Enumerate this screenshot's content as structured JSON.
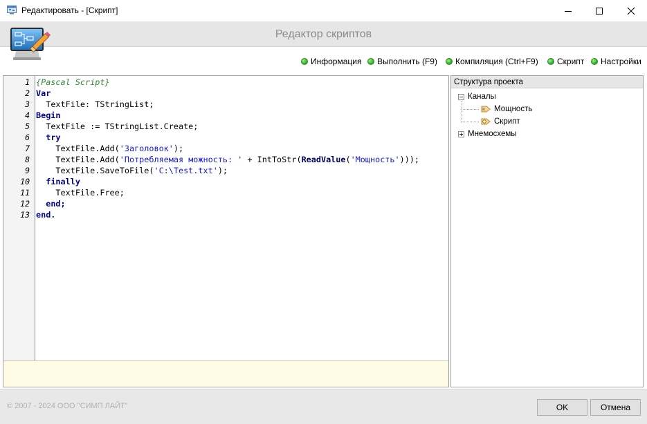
{
  "window": {
    "title": "Редактировать - [Скрипт]"
  },
  "header": {
    "title": "Редактор скриптов"
  },
  "toolbar": {
    "items": [
      {
        "label": "Информация",
        "icon": "green-dot-icon"
      },
      {
        "label": "Выполнить (F9)",
        "icon": "green-dot-icon"
      },
      {
        "label": "Компиляция (Ctrl+F9)",
        "icon": "green-dot-icon"
      },
      {
        "label": "Скрипт",
        "icon": "green-dot-icon"
      },
      {
        "label": "Настройки",
        "icon": "green-dot-icon"
      }
    ]
  },
  "editor": {
    "line_numbers": [
      "1",
      "2",
      "3",
      "4",
      "5",
      "6",
      "7",
      "8",
      "9",
      "10",
      "11",
      "12",
      "13"
    ],
    "lines": [
      {
        "indent": "",
        "parts": [
          {
            "t": "{Pascal Script}",
            "c": "cm"
          }
        ]
      },
      {
        "indent": "",
        "parts": [
          {
            "t": "Var",
            "c": "kw"
          }
        ]
      },
      {
        "indent": "  ",
        "parts": [
          {
            "t": "TextFile: TStringList;",
            "c": ""
          }
        ]
      },
      {
        "indent": "",
        "parts": [
          {
            "t": "Begin",
            "c": "kw"
          }
        ]
      },
      {
        "indent": "  ",
        "parts": [
          {
            "t": "TextFile := TStringList.Create;",
            "c": ""
          }
        ]
      },
      {
        "indent": "  ",
        "parts": [
          {
            "t": "try",
            "c": "kw"
          }
        ]
      },
      {
        "indent": "    ",
        "parts": [
          {
            "t": "TextFile.Add(",
            "c": ""
          },
          {
            "t": "'Заголовок'",
            "c": "str"
          },
          {
            "t": ");",
            "c": ""
          }
        ]
      },
      {
        "indent": "    ",
        "parts": [
          {
            "t": "TextFile.Add(",
            "c": ""
          },
          {
            "t": "'Потребляемая можность: '",
            "c": "str"
          },
          {
            "t": " + IntToStr(",
            "c": ""
          },
          {
            "t": "ReadValue",
            "c": "fn"
          },
          {
            "t": "(",
            "c": ""
          },
          {
            "t": "'Мощность'",
            "c": "str"
          },
          {
            "t": ")));",
            "c": ""
          }
        ]
      },
      {
        "indent": "    ",
        "parts": [
          {
            "t": "TextFile.SaveToFile(",
            "c": ""
          },
          {
            "t": "'C:\\Test.txt'",
            "c": "str"
          },
          {
            "t": ");",
            "c": ""
          }
        ]
      },
      {
        "indent": "  ",
        "parts": [
          {
            "t": "finally",
            "c": "kw"
          }
        ]
      },
      {
        "indent": "    ",
        "parts": [
          {
            "t": "TextFile.Free;",
            "c": ""
          }
        ]
      },
      {
        "indent": "  ",
        "parts": [
          {
            "t": "end;",
            "c": "kw"
          }
        ]
      },
      {
        "indent": "",
        "parts": [
          {
            "t": "end.",
            "c": "kw"
          }
        ]
      }
    ]
  },
  "tree": {
    "header": "Структура проекта",
    "root_channels": "Каналы",
    "child_power": "Мощность",
    "child_script": "Скрипт",
    "root_schemes": "Мнемосхемы"
  },
  "footer": {
    "copyright": "© 2007 - 2024  ООО \"СИМП ЛАЙТ\"",
    "ok_label": "OK",
    "cancel_label": "Отмена"
  },
  "colors": {
    "accent_green": "#3fb53a",
    "keyword": "#00008b",
    "string": "#1515d8",
    "comment": "#2e8b2e",
    "message_area": "#fffbe5"
  }
}
